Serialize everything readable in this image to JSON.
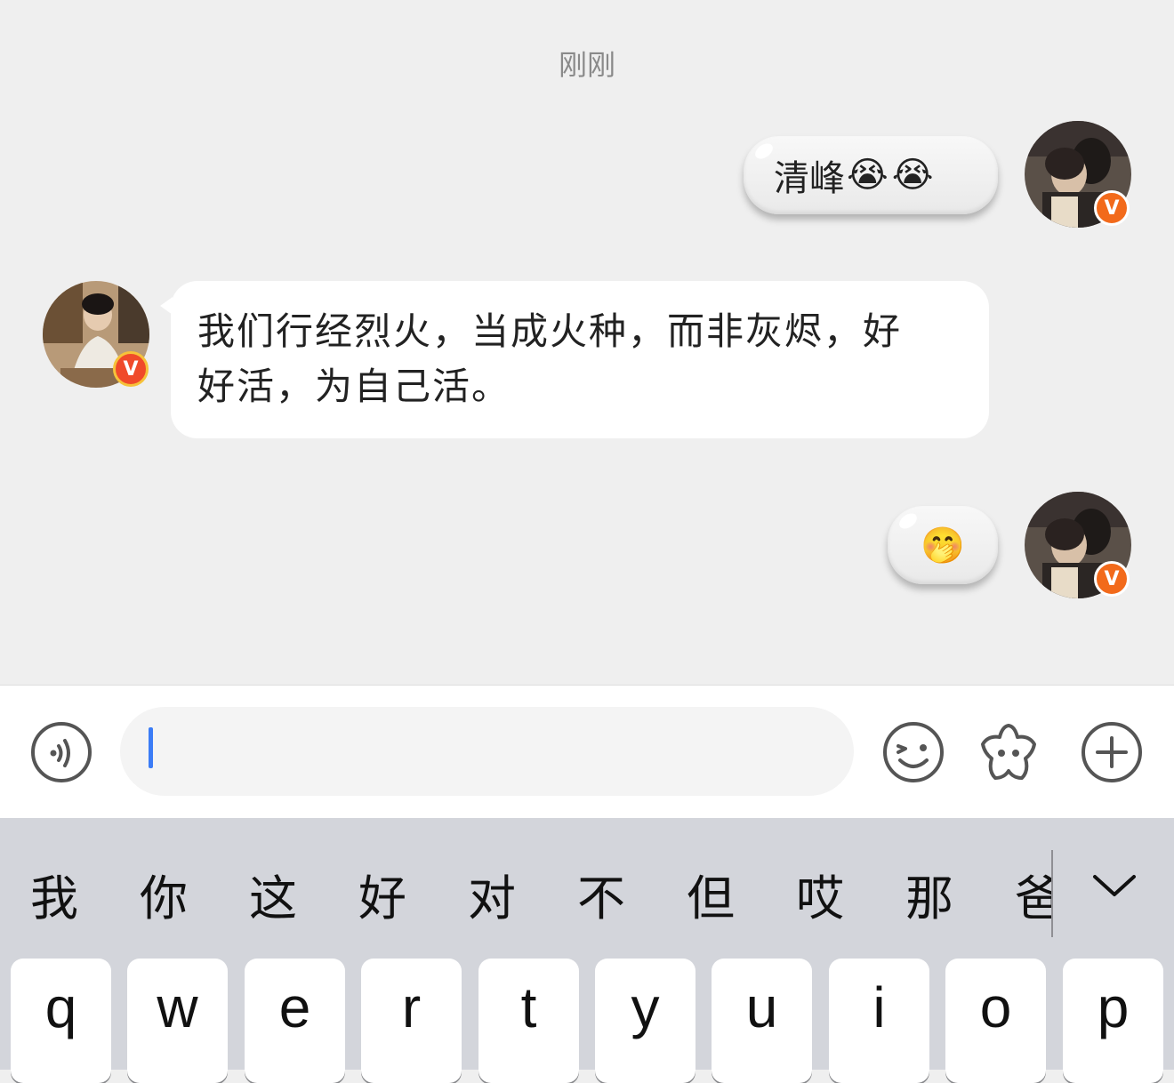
{
  "chat": {
    "timestamp": "刚刚",
    "messages": [
      {
        "side": "out",
        "text": "清峰",
        "emojis": [
          "😭",
          "😭"
        ]
      },
      {
        "side": "in",
        "text_line1": "我们行经烈火，当成火种，而非灰烬，好",
        "text_line2": "好活，为自己活。"
      },
      {
        "side": "out",
        "text": "",
        "emojis": [
          "🤭"
        ]
      }
    ],
    "badge_label": "V"
  },
  "inputbar": {
    "voice_icon": "voice-icon",
    "input_value": "",
    "emoji_icon": "emoji-icon",
    "sticker_icon": "sticker-icon",
    "plus_icon": "plus-icon"
  },
  "keyboard": {
    "candidates": [
      "我",
      "你",
      "这",
      "好",
      "对",
      "不",
      "但",
      "哎",
      "那",
      "爸"
    ],
    "expand_icon": "chevron-down-icon",
    "keys": [
      "q",
      "w",
      "e",
      "r",
      "t",
      "y",
      "u",
      "i",
      "o",
      "p"
    ]
  },
  "colors": {
    "background": "#efefef",
    "badge": "#f26a1b",
    "cursor": "#3b7cf6",
    "keyboard": "#d3d5db"
  }
}
